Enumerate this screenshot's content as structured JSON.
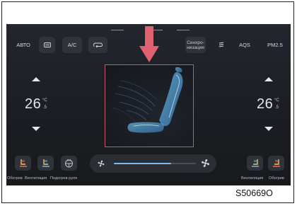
{
  "top_bar": {
    "auto_label": "АВТО",
    "ac_label": "A/C",
    "sync_label": "Синхро-\nнизация",
    "aqs_label": "AQS",
    "pm_label": "PM2.5"
  },
  "left_zone": {
    "temperature": "26",
    "unit_top": "°C",
    "unit_bottom": ".5"
  },
  "right_zone": {
    "temperature": "26",
    "unit_top": "°C",
    "unit_bottom": ".5"
  },
  "bottom": {
    "label_heating": "Обогрев",
    "label_ventilation": "Вентиляция",
    "label_wheel_heating": "Подогрев руля",
    "label_ventilation_right": "Вентиляция",
    "label_heating_right": "Обогрев",
    "fan_level": 0.7
  },
  "caption": "S50669O",
  "colors": {
    "accent_red": "#e0616f",
    "screen_bg": "#1e2026",
    "fan_blue": "#7fb8f0",
    "seat_blue": "#7fc0e8",
    "heat_red": "#ff6a4d"
  }
}
